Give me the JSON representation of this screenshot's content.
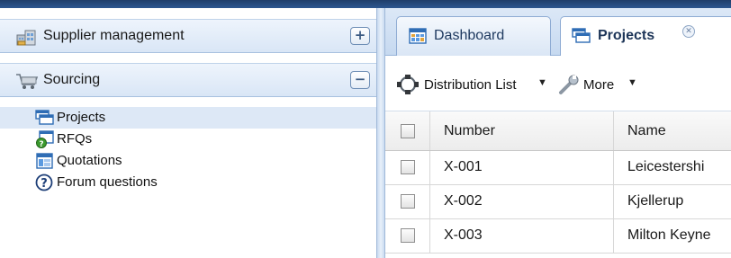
{
  "sidebar": {
    "sections": [
      {
        "label": "Supplier management",
        "icon": "building-icon",
        "toggle": "+",
        "expanded": false
      },
      {
        "label": "Sourcing",
        "icon": "cart-icon",
        "toggle": "−",
        "expanded": true
      }
    ],
    "items": [
      {
        "label": "Projects",
        "icon": "projects-icon",
        "selected": true
      },
      {
        "label": "RFQs",
        "icon": "rfq-icon",
        "selected": false
      },
      {
        "label": "Quotations",
        "icon": "quotations-icon",
        "selected": false
      },
      {
        "label": "Forum questions",
        "icon": "question-icon",
        "selected": false
      }
    ]
  },
  "tabs": [
    {
      "label": "Dashboard",
      "icon": "dashboard-icon",
      "active": false
    },
    {
      "label": "Projects",
      "icon": "projects-icon",
      "active": true,
      "close_glyph": "✕"
    }
  ],
  "toolbar": {
    "distribution_label": "Distribution List",
    "more_label": "More",
    "caret": "▼"
  },
  "grid": {
    "columns": [
      "Number",
      "Name"
    ],
    "rows": [
      {
        "number": "X-001",
        "name": "Leicestershi"
      },
      {
        "number": "X-002",
        "name": "Kjellerup"
      },
      {
        "number": "X-003",
        "name": "Milton Keyne"
      }
    ]
  },
  "colors": {
    "header_bar": "#2d5790",
    "selection": "#dde8f6",
    "tab_strip": "#c6d9f0"
  }
}
